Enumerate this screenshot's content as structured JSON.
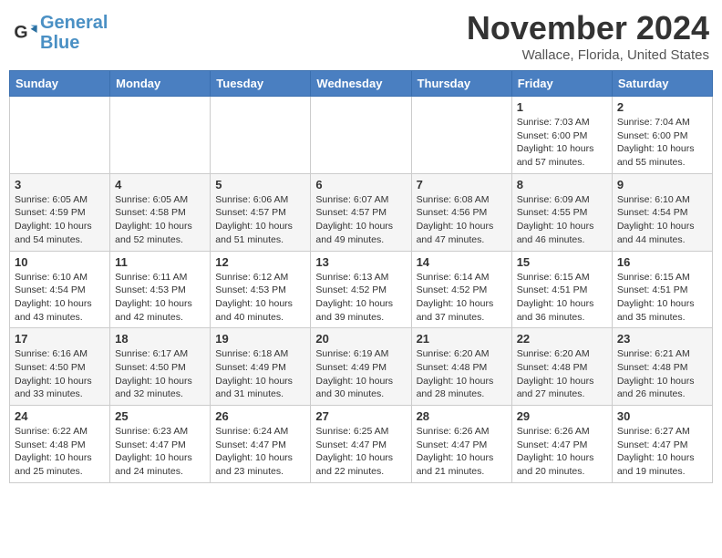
{
  "header": {
    "logo_line1": "General",
    "logo_line2": "Blue",
    "month": "November 2024",
    "location": "Wallace, Florida, United States"
  },
  "weekdays": [
    "Sunday",
    "Monday",
    "Tuesday",
    "Wednesday",
    "Thursday",
    "Friday",
    "Saturday"
  ],
  "weeks": [
    [
      {
        "day": "",
        "info": ""
      },
      {
        "day": "",
        "info": ""
      },
      {
        "day": "",
        "info": ""
      },
      {
        "day": "",
        "info": ""
      },
      {
        "day": "",
        "info": ""
      },
      {
        "day": "1",
        "info": "Sunrise: 7:03 AM\nSunset: 6:00 PM\nDaylight: 10 hours and 57 minutes."
      },
      {
        "day": "2",
        "info": "Sunrise: 7:04 AM\nSunset: 6:00 PM\nDaylight: 10 hours and 55 minutes."
      }
    ],
    [
      {
        "day": "3",
        "info": "Sunrise: 6:05 AM\nSunset: 4:59 PM\nDaylight: 10 hours and 54 minutes."
      },
      {
        "day": "4",
        "info": "Sunrise: 6:05 AM\nSunset: 4:58 PM\nDaylight: 10 hours and 52 minutes."
      },
      {
        "day": "5",
        "info": "Sunrise: 6:06 AM\nSunset: 4:57 PM\nDaylight: 10 hours and 51 minutes."
      },
      {
        "day": "6",
        "info": "Sunrise: 6:07 AM\nSunset: 4:57 PM\nDaylight: 10 hours and 49 minutes."
      },
      {
        "day": "7",
        "info": "Sunrise: 6:08 AM\nSunset: 4:56 PM\nDaylight: 10 hours and 47 minutes."
      },
      {
        "day": "8",
        "info": "Sunrise: 6:09 AM\nSunset: 4:55 PM\nDaylight: 10 hours and 46 minutes."
      },
      {
        "day": "9",
        "info": "Sunrise: 6:10 AM\nSunset: 4:54 PM\nDaylight: 10 hours and 44 minutes."
      }
    ],
    [
      {
        "day": "10",
        "info": "Sunrise: 6:10 AM\nSunset: 4:54 PM\nDaylight: 10 hours and 43 minutes."
      },
      {
        "day": "11",
        "info": "Sunrise: 6:11 AM\nSunset: 4:53 PM\nDaylight: 10 hours and 42 minutes."
      },
      {
        "day": "12",
        "info": "Sunrise: 6:12 AM\nSunset: 4:53 PM\nDaylight: 10 hours and 40 minutes."
      },
      {
        "day": "13",
        "info": "Sunrise: 6:13 AM\nSunset: 4:52 PM\nDaylight: 10 hours and 39 minutes."
      },
      {
        "day": "14",
        "info": "Sunrise: 6:14 AM\nSunset: 4:52 PM\nDaylight: 10 hours and 37 minutes."
      },
      {
        "day": "15",
        "info": "Sunrise: 6:15 AM\nSunset: 4:51 PM\nDaylight: 10 hours and 36 minutes."
      },
      {
        "day": "16",
        "info": "Sunrise: 6:15 AM\nSunset: 4:51 PM\nDaylight: 10 hours and 35 minutes."
      }
    ],
    [
      {
        "day": "17",
        "info": "Sunrise: 6:16 AM\nSunset: 4:50 PM\nDaylight: 10 hours and 33 minutes."
      },
      {
        "day": "18",
        "info": "Sunrise: 6:17 AM\nSunset: 4:50 PM\nDaylight: 10 hours and 32 minutes."
      },
      {
        "day": "19",
        "info": "Sunrise: 6:18 AM\nSunset: 4:49 PM\nDaylight: 10 hours and 31 minutes."
      },
      {
        "day": "20",
        "info": "Sunrise: 6:19 AM\nSunset: 4:49 PM\nDaylight: 10 hours and 30 minutes."
      },
      {
        "day": "21",
        "info": "Sunrise: 6:20 AM\nSunset: 4:48 PM\nDaylight: 10 hours and 28 minutes."
      },
      {
        "day": "22",
        "info": "Sunrise: 6:20 AM\nSunset: 4:48 PM\nDaylight: 10 hours and 27 minutes."
      },
      {
        "day": "23",
        "info": "Sunrise: 6:21 AM\nSunset: 4:48 PM\nDaylight: 10 hours and 26 minutes."
      }
    ],
    [
      {
        "day": "24",
        "info": "Sunrise: 6:22 AM\nSunset: 4:48 PM\nDaylight: 10 hours and 25 minutes."
      },
      {
        "day": "25",
        "info": "Sunrise: 6:23 AM\nSunset: 4:47 PM\nDaylight: 10 hours and 24 minutes."
      },
      {
        "day": "26",
        "info": "Sunrise: 6:24 AM\nSunset: 4:47 PM\nDaylight: 10 hours and 23 minutes."
      },
      {
        "day": "27",
        "info": "Sunrise: 6:25 AM\nSunset: 4:47 PM\nDaylight: 10 hours and 22 minutes."
      },
      {
        "day": "28",
        "info": "Sunrise: 6:26 AM\nSunset: 4:47 PM\nDaylight: 10 hours and 21 minutes."
      },
      {
        "day": "29",
        "info": "Sunrise: 6:26 AM\nSunset: 4:47 PM\nDaylight: 10 hours and 20 minutes."
      },
      {
        "day": "30",
        "info": "Sunrise: 6:27 AM\nSunset: 4:47 PM\nDaylight: 10 hours and 19 minutes."
      }
    ]
  ]
}
